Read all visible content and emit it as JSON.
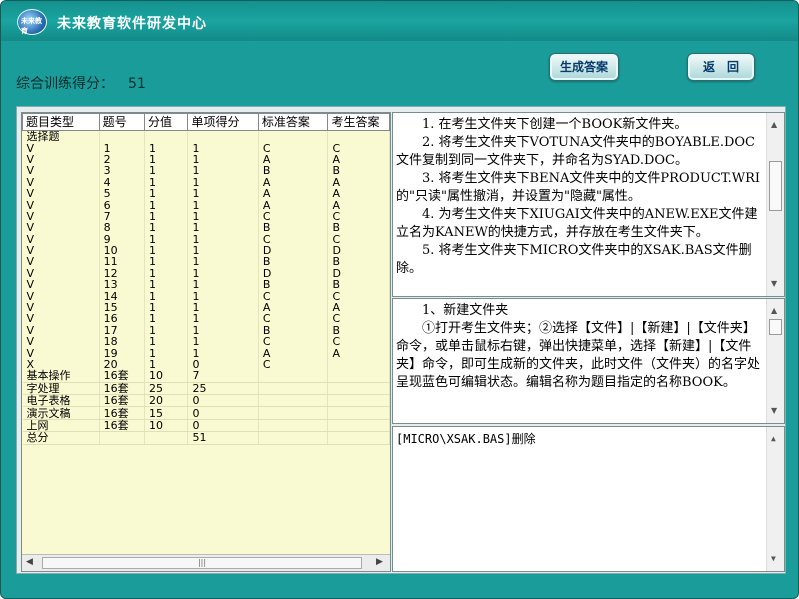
{
  "window": {
    "title": "未来教育软件研发中心",
    "logo_text": "未来教育"
  },
  "score": {
    "label": "综合训练得分：",
    "value": "51"
  },
  "buttons": {
    "generate": "生成答案",
    "back": "返　回"
  },
  "table": {
    "headers": [
      "题目类型",
      "题号",
      "分值",
      "单项得分",
      "标准答案",
      "考生答案"
    ],
    "rows": [
      [
        "选择题",
        "",
        "",
        "",
        "",
        ""
      ],
      [
        "V",
        "1",
        "1",
        "1",
        "C",
        "C"
      ],
      [
        "V",
        "2",
        "1",
        "1",
        "A",
        "A"
      ],
      [
        "V",
        "3",
        "1",
        "1",
        "B",
        "B"
      ],
      [
        "V",
        "4",
        "1",
        "1",
        "A",
        "A"
      ],
      [
        "V",
        "5",
        "1",
        "1",
        "A",
        "A"
      ],
      [
        "V",
        "6",
        "1",
        "1",
        "A",
        "A"
      ],
      [
        "V",
        "7",
        "1",
        "1",
        "C",
        "C"
      ],
      [
        "V",
        "8",
        "1",
        "1",
        "B",
        "B"
      ],
      [
        "V",
        "9",
        "1",
        "1",
        "C",
        "C"
      ],
      [
        "V",
        "10",
        "1",
        "1",
        "D",
        "D"
      ],
      [
        "V",
        "11",
        "1",
        "1",
        "B",
        "B"
      ],
      [
        "V",
        "12",
        "1",
        "1",
        "D",
        "D"
      ],
      [
        "V",
        "13",
        "1",
        "1",
        "B",
        "B"
      ],
      [
        "V",
        "14",
        "1",
        "1",
        "C",
        "C"
      ],
      [
        "V",
        "15",
        "1",
        "1",
        "A",
        "A"
      ],
      [
        "V",
        "16",
        "1",
        "1",
        "C",
        "C"
      ],
      [
        "V",
        "17",
        "1",
        "1",
        "B",
        "B"
      ],
      [
        "V",
        "18",
        "1",
        "1",
        "C",
        "C"
      ],
      [
        "V",
        "19",
        "1",
        "1",
        "A",
        "A"
      ],
      [
        "X",
        "20",
        "1",
        "0",
        "C",
        ""
      ],
      [
        "基本操作",
        "16套",
        "10",
        "7",
        "",
        ""
      ],
      [
        "字处理",
        "16套",
        "25",
        "25",
        "",
        ""
      ],
      [
        "电子表格",
        "16套",
        "20",
        "0",
        "",
        ""
      ],
      [
        "演示文稿",
        "16套",
        "15",
        "0",
        "",
        ""
      ],
      [
        "上网",
        "16套",
        "10",
        "0",
        "",
        ""
      ],
      [
        "总分",
        "",
        "",
        "51",
        "",
        ""
      ]
    ],
    "scroll_thumb_glyph": "|||"
  },
  "question_text": [
    "1. 在考生文件夹下创建一个BOOK新文件夹。",
    "2. 将考生文件夹下VOTUNA文件夹中的BOYABLE.DOC文件复制到同一文件夹下，并命名为SYAD.DOC。",
    "3. 将考生文件夹下BENA文件夹中的文件PRODUCT.WRI的\"只读\"属性撤消，并设置为\"隐藏\"属性。",
    "4. 为考生文件夹下XIUGAI文件夹中的ANEW.EXE文件建立名为KANEW的快捷方式，并存放在考生文件夹下。",
    "5. 将考生文件夹下MICRO文件夹中的XSAK.BAS文件删除。"
  ],
  "solution_text": [
    "1、新建文件夹",
    "①打开考生文件夹；②选择【文件】|【新建】|【文件夹】命令，或单击鼠标右键，弹出快捷菜单，选择【新建】|【文件夹】命令，即可生成新的文件夹，此时文件（文件夹）的名字处呈现蓝色可编辑状态。编辑名称为题目指定的名称BOOK。"
  ],
  "result_text": "[MICRO\\XSAK.BAS]删除",
  "colors": {
    "background": "#1a9d9a",
    "grid_bg": "#fafad2",
    "ok_mark": "#1a24c8",
    "wrong_mark": "#d51212"
  },
  "icons": {
    "scroll_up": "▲",
    "scroll_down": "▼",
    "scroll_left": "◀",
    "scroll_right": "▶"
  }
}
